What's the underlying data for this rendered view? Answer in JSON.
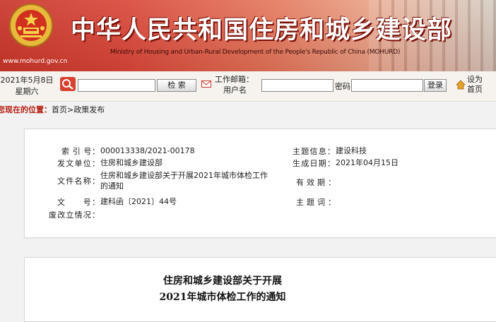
{
  "header": {
    "site_title": "中华人民共和国住房和城乡建设部",
    "site_subtitle": "Ministry of Housing and Urban-Rural Development of the People's Republic of China (MOHURD)",
    "site_url": "www.mohurd.gov.cn",
    "emblem_icon": "national-emblem-icon"
  },
  "toolbar": {
    "date": "2021年5月8日",
    "weekday": "星期六",
    "search_input_value": "",
    "search_button": "检 索",
    "mail_label_line1": "工作邮箱：",
    "mail_label_line2": "用户名",
    "username_value": "",
    "password_label": "密码",
    "password_value": "",
    "login_button": "登录",
    "homepage_line1": "设为",
    "homepage_line2": "首页"
  },
  "breadcrumb": {
    "here_label": "您现在的位置：",
    "home": "首页",
    "separator": ">",
    "current": "政策发布"
  },
  "info": {
    "index_label": "索 引 号：",
    "index_value": "000013338/2021-00178",
    "issuer_label": "发文单位：",
    "issuer_value": "住房和城乡建设部",
    "docname_label": "文件名称：",
    "docname_value": "住房和城乡建设部关于开展2021年城市体检工作的通知",
    "docno_label": "文　　号：",
    "docno_value": "建科函〔2021〕44号",
    "status_label": "废改立情况：",
    "status_value": "",
    "topic_label": "主题信息：",
    "topic_value": "建设科技",
    "date_label": "生成日期：",
    "date_value": "2021年04月15日",
    "validity_label": "有 效 期 ：",
    "validity_value": "",
    "keywords_label": "主 题 词 ：",
    "keywords_value": ""
  },
  "article": {
    "title_line1": "住房和城乡建设部关于开展",
    "title_line2": "2021年城市体检工作的通知"
  },
  "colors": {
    "brand_red": "#c9372c",
    "breadcrumb_red": "#b51d12",
    "emblem_gold": "#e8b93a"
  }
}
